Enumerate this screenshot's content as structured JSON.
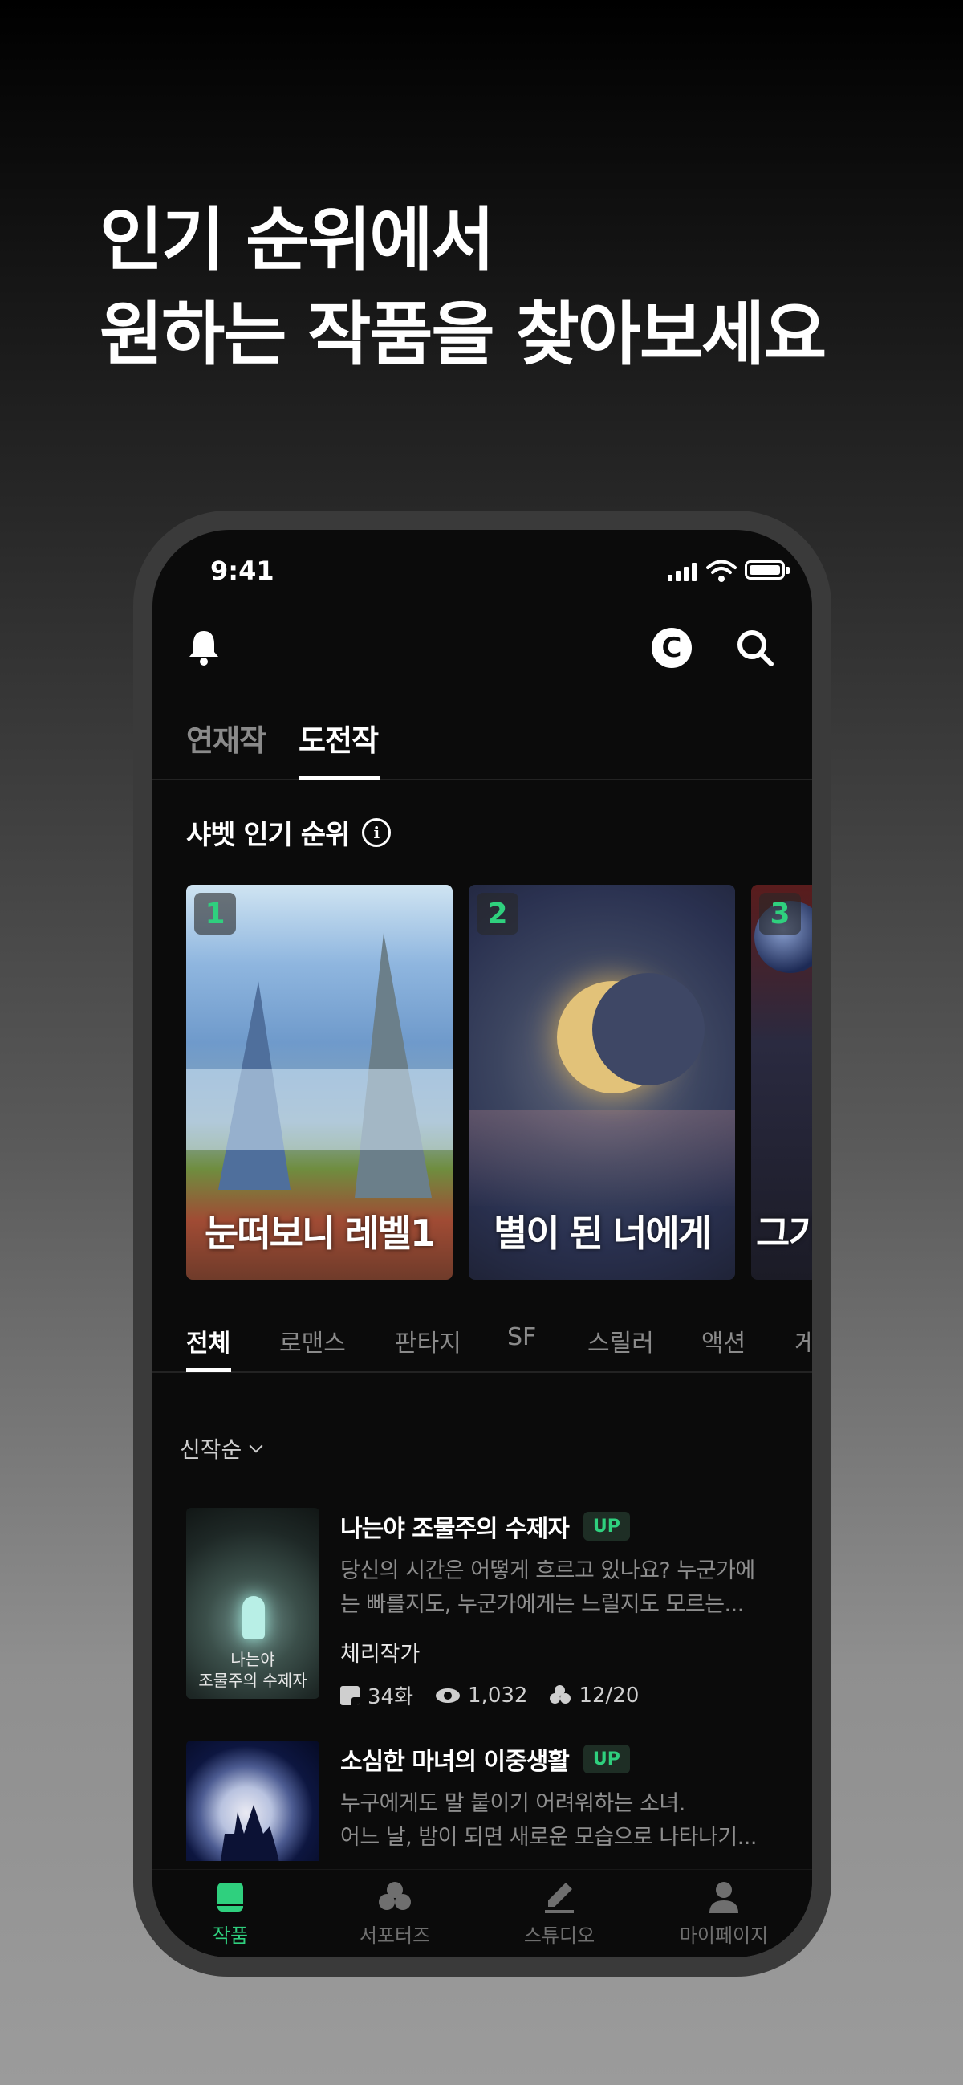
{
  "headline": {
    "line1": "인기 순위에서",
    "line2": "원하는 작품을 찾아보세요"
  },
  "status_bar": {
    "time": "9:41"
  },
  "topbar": {
    "bell_icon": "bell-icon",
    "coin_icon": "c-coin-icon",
    "coin_letter": "C",
    "search_icon": "search-icon"
  },
  "tabs": [
    {
      "label": "연재작",
      "active": false
    },
    {
      "label": "도전작",
      "active": true
    }
  ],
  "ranking": {
    "title": "샤벳 인기 순위",
    "info_icon": "info-icon",
    "info_glyph": "i",
    "items": [
      {
        "rank": "1",
        "title": "눈떠보니 레벨1"
      },
      {
        "rank": "2",
        "title": "별이 된 너에게"
      },
      {
        "rank": "3",
        "title": "그기"
      }
    ]
  },
  "genres": [
    "전체",
    "로맨스",
    "판타지",
    "SF",
    "스릴러",
    "액션",
    "게"
  ],
  "sort": {
    "label": "신작순"
  },
  "works": [
    {
      "title": "나는야 조물주의 수제자",
      "badge": "UP",
      "desc1": "당신의 시간은 어떻게 흐르고 있나요? 누군가에",
      "desc2": "는 빠를지도, 누군가에게는 느릴지도 모르는...",
      "author": "체리작가",
      "episodes": "34화",
      "views": "1,032",
      "supporters": "12/20",
      "thumb_text1": "나는야",
      "thumb_text2": "조물주의 수제자"
    },
    {
      "title": "소심한 마녀의 이중생활",
      "badge": "UP",
      "desc1": "누구에게도 말 붙이기 어려워하는 소녀.",
      "desc2": "어느 날, 밤이 되면 새로운 모습으로 나타나기..."
    }
  ],
  "bottom_nav": [
    {
      "label": "작품",
      "icon": "book-icon",
      "active": true
    },
    {
      "label": "서포터즈",
      "icon": "club-icon",
      "active": false
    },
    {
      "label": "스튜디오",
      "icon": "pen-icon",
      "active": false
    },
    {
      "label": "마이페이지",
      "icon": "person-icon",
      "active": false
    }
  ],
  "colors": {
    "accent": "#2fd07e",
    "background": "#0b0b0b"
  }
}
